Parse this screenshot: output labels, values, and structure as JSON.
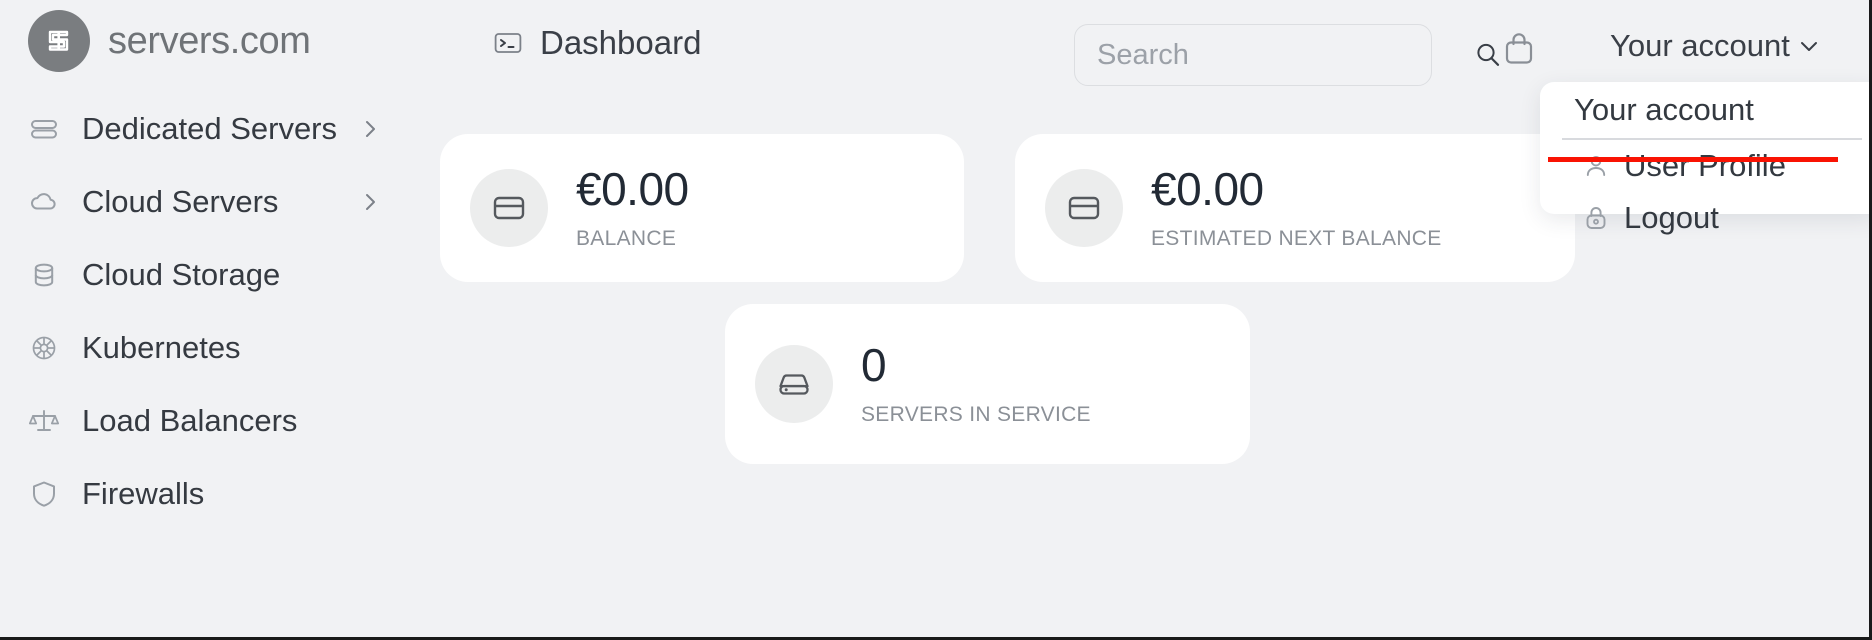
{
  "brand": {
    "name": "servers.com",
    "logo_icon": "servers-s-logo-icon"
  },
  "header": {
    "page_icon": "terminal-icon",
    "page_title": "Dashboard",
    "search": {
      "value": "",
      "placeholder": "Search",
      "icon": "search-icon"
    },
    "cart_icon": "shopping-bag-icon",
    "account_label": "Your account",
    "account_chevron_icon": "chevron-down-icon"
  },
  "sidebar": {
    "items": [
      {
        "label": "Dedicated Servers",
        "icon": "stacked-servers-icon",
        "has_chevron": true
      },
      {
        "label": "Cloud Servers",
        "icon": "cloud-icon",
        "has_chevron": true
      },
      {
        "label": "Cloud Storage",
        "icon": "database-icon",
        "has_chevron": false
      },
      {
        "label": "Kubernetes",
        "icon": "ship-wheel-icon",
        "has_chevron": false
      },
      {
        "label": "Load Balancers",
        "icon": "balance-scale-icon",
        "has_chevron": false
      },
      {
        "label": "Firewalls",
        "icon": "shield-icon",
        "has_chevron": false
      }
    ]
  },
  "main": {
    "cards": [
      {
        "value": "€0.00",
        "label": "BALANCE",
        "icon": "credit-card-icon"
      },
      {
        "value": "€0.00",
        "label": "ESTIMATED NEXT BALANCE",
        "icon": "credit-card-icon"
      },
      {
        "value": "0",
        "label": "SERVERS IN SERVICE",
        "icon": "server-drive-icon"
      }
    ]
  },
  "dropdown": {
    "title": "Your account",
    "items": [
      {
        "label": "User Profile",
        "icon": "user-icon"
      },
      {
        "label": "Logout",
        "icon": "lock-icon"
      }
    ],
    "highlight_color": "#f91303"
  },
  "colors": {
    "page_background": "#f1f2f4",
    "card_background": "#ffffff",
    "brand_gray": "#7a7d80",
    "text_dark": "#333940",
    "text_muted": "#8b9097",
    "accent_red": "#f91303"
  }
}
